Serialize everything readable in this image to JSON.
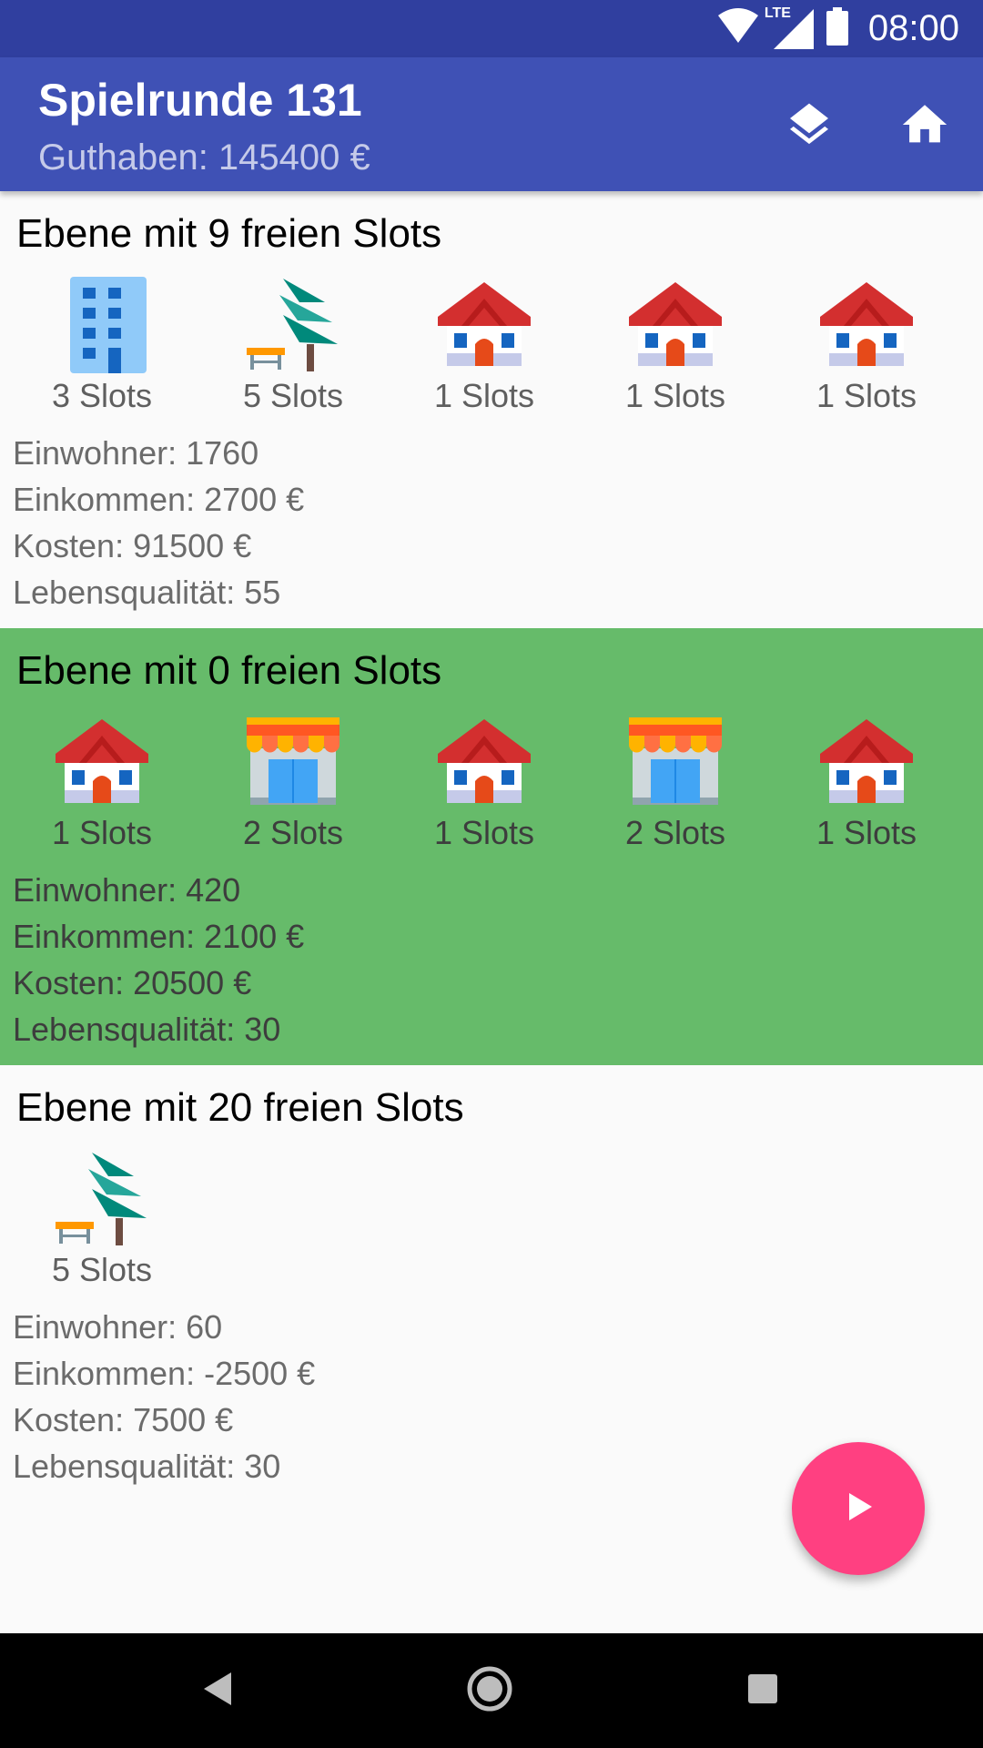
{
  "status_bar": {
    "time": "08:00",
    "network": "LTE",
    "icons": [
      "wifi-icon",
      "lte-signal-icon",
      "battery-icon"
    ]
  },
  "app_bar": {
    "title": "Spielrunde 131",
    "subtitle": "Guthaben: 145400 €",
    "actions": [
      "layers-icon",
      "home-icon"
    ]
  },
  "levels": [
    {
      "title": "Ebene mit 9 freien Slots",
      "selected": false,
      "buildings": [
        {
          "icon": "office-building-icon",
          "slots": "3 Slots"
        },
        {
          "icon": "park-icon",
          "slots": "5 Slots"
        },
        {
          "icon": "house-icon",
          "slots": "1 Slots"
        },
        {
          "icon": "house-icon",
          "slots": "1 Slots"
        },
        {
          "icon": "house-icon",
          "slots": "1 Slots"
        }
      ],
      "stats": {
        "einwohner": "Einwohner: 1760",
        "einkommen": "Einkommen: 2700 €",
        "kosten": "Kosten: 91500 €",
        "lebensqualitaet": "Lebensqualität: 55"
      }
    },
    {
      "title": "Ebene mit 0 freien Slots",
      "selected": true,
      "buildings": [
        {
          "icon": "house-icon",
          "slots": "1 Slots"
        },
        {
          "icon": "shop-icon",
          "slots": "2 Slots"
        },
        {
          "icon": "house-icon",
          "slots": "1 Slots"
        },
        {
          "icon": "shop-icon",
          "slots": "2 Slots"
        },
        {
          "icon": "house-icon",
          "slots": "1 Slots"
        }
      ],
      "stats": {
        "einwohner": "Einwohner: 420",
        "einkommen": "Einkommen: 2100 €",
        "kosten": "Kosten: 20500 €",
        "lebensqualitaet": "Lebensqualität: 30"
      }
    },
    {
      "title": "Ebene mit 20 freien Slots",
      "selected": false,
      "buildings": [
        {
          "icon": "park-icon",
          "slots": "5 Slots"
        }
      ],
      "stats": {
        "einwohner": "Einwohner: 60",
        "einkommen": "Einkommen: -2500 €",
        "kosten": "Kosten: 7500 €",
        "lebensqualitaet": "Lebensqualität: 30"
      }
    }
  ],
  "fab": {
    "icon": "play-icon"
  },
  "nav_bar": {
    "icons": [
      "back-icon",
      "home-circle-icon",
      "recents-icon"
    ]
  },
  "colors": {
    "primary": "#3f51b5",
    "primary_dark": "#303f9f",
    "accent": "#ff4081",
    "selected_level": "#66bb6a"
  }
}
